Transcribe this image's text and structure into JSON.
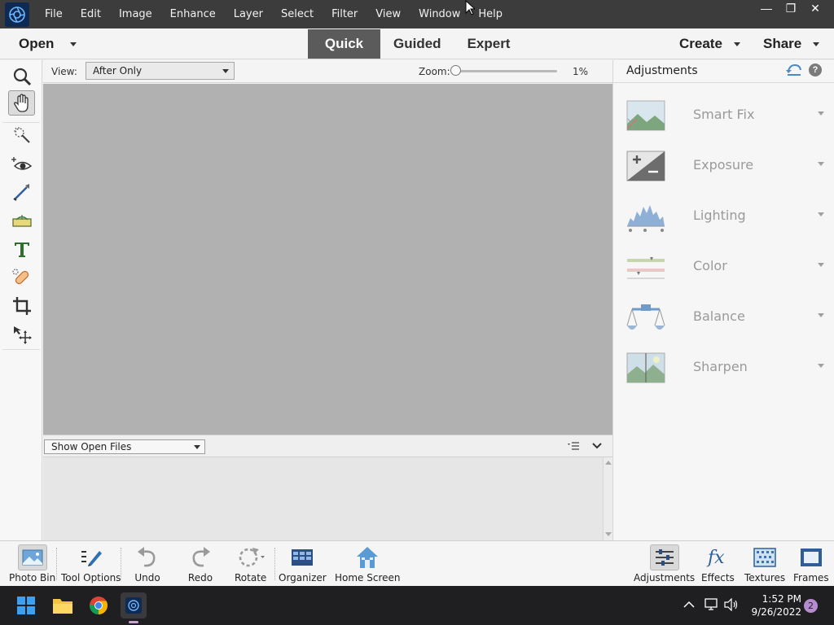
{
  "menubar": {
    "items": [
      "File",
      "Edit",
      "Image",
      "Enhance",
      "Layer",
      "Select",
      "Filter",
      "View",
      "Window",
      "Help"
    ],
    "minimize": "—",
    "restore": "❐",
    "close": "✕"
  },
  "modebar": {
    "open_label": "Open",
    "tabs": [
      {
        "label": "Quick",
        "active": true
      },
      {
        "label": "Guided",
        "active": false
      },
      {
        "label": "Expert",
        "active": false
      }
    ],
    "create_label": "Create",
    "share_label": "Share"
  },
  "toolbox": {
    "tools": [
      "zoom-tool",
      "hand-tool",
      "quick-selection-tool",
      "red-eye-removal-tool",
      "whiten-teeth-tool",
      "straighten-tool",
      "type-tool",
      "spot-healing-brush-tool",
      "crop-tool",
      "move-tool"
    ],
    "active_tool": "hand-tool"
  },
  "options": {
    "view_label": "View:",
    "view_value": "After Only",
    "zoom_label": "Zoom:",
    "zoom_value": "1%"
  },
  "photo_bin": {
    "select_value": "Show Open Files"
  },
  "adjustments": {
    "title": "Adjustments",
    "items": [
      {
        "label": "Smart Fix",
        "icon": "smart-fix-icon"
      },
      {
        "label": "Exposure",
        "icon": "exposure-icon"
      },
      {
        "label": "Lighting",
        "icon": "lighting-icon"
      },
      {
        "label": "Color",
        "icon": "color-icon"
      },
      {
        "label": "Balance",
        "icon": "balance-icon"
      },
      {
        "label": "Sharpen",
        "icon": "sharpen-icon"
      }
    ]
  },
  "bottombar": {
    "left": [
      {
        "label": "Photo Bin",
        "icon": "photo-bin-icon",
        "active": true
      },
      {
        "label": "Tool Options",
        "icon": "tool-options-icon"
      },
      {
        "label": "Undo",
        "icon": "undo-icon"
      },
      {
        "label": "Redo",
        "icon": "redo-icon"
      },
      {
        "label": "Rotate",
        "icon": "rotate-icon"
      },
      {
        "label": "Organizer",
        "icon": "organizer-icon"
      },
      {
        "label": "Home Screen",
        "icon": "home-icon"
      }
    ],
    "right": [
      {
        "label": "Adjustments",
        "icon": "adjustments-icon",
        "active": true
      },
      {
        "label": "Effects",
        "icon": "effects-icon"
      },
      {
        "label": "Textures",
        "icon": "textures-icon"
      },
      {
        "label": "Frames",
        "icon": "frames-icon"
      }
    ]
  },
  "taskbar": {
    "time": "1:52 PM",
    "date": "9/26/2022",
    "notification_count": "2"
  },
  "colors": {
    "menubar_bg": "#3c3c3c",
    "active_tab_bg": "#5b5b5b",
    "canvas_bg": "#b1b1b1",
    "taskbar_bg": "#1f1f22"
  }
}
